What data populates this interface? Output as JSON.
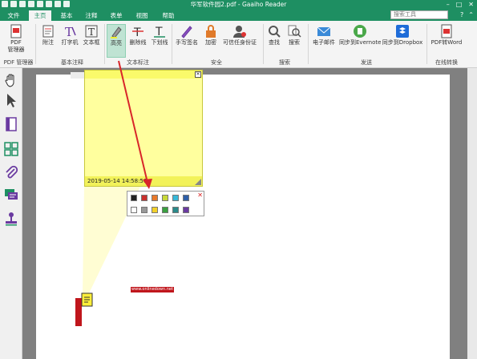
{
  "window": {
    "title": "华军软件园2.pdf - Gaaiho Reader"
  },
  "tabs": [
    {
      "label": "文件"
    },
    {
      "label": "主页"
    },
    {
      "label": "基本"
    },
    {
      "label": "注释"
    },
    {
      "label": "表单"
    },
    {
      "label": "视图"
    },
    {
      "label": "帮助"
    }
  ],
  "search": {
    "placeholder": "搜索工具"
  },
  "ribbon": {
    "buttons": [
      {
        "label": "PDF\n管理器"
      },
      {
        "label": "附注"
      },
      {
        "label": "打字机"
      },
      {
        "label": "文本框"
      },
      {
        "label": "高亮"
      },
      {
        "label": "删除线"
      },
      {
        "label": "下划线"
      },
      {
        "label": "手写签名"
      },
      {
        "label": "加密"
      },
      {
        "label": "可信任身份证"
      },
      {
        "label": "查找"
      },
      {
        "label": "搜索"
      },
      {
        "label": "电子邮件"
      },
      {
        "label": "同步到Evernote"
      },
      {
        "label": "同步到Dropbox"
      },
      {
        "label": "PDF转Word"
      }
    ],
    "groups": [
      {
        "label": "PDF 管理器"
      },
      {
        "label": "基本注释"
      },
      {
        "label": "文本标注"
      },
      {
        "label": "安全"
      },
      {
        "label": "搜索"
      },
      {
        "label": "发送"
      },
      {
        "label": "在线转换"
      }
    ]
  },
  "note": {
    "timestamp": "2019-05-14 14:58:56"
  },
  "palette": {
    "colors_row1": [
      "#222222",
      "#c9302c",
      "#e8782a",
      "#c8d838",
      "#38b8d8",
      "#2e5fa8",
      "#444444"
    ],
    "colors_row2": [
      "#ffffff",
      "#999999",
      "#f2d02a",
      "#3aa040",
      "#2a8a8a",
      "#6a3aa0",
      "#8a8a8a"
    ]
  },
  "annotation": {
    "tag_text": "www.onlinedown.net"
  },
  "colors": {
    "brand": "#1e8f62",
    "note_bg": "#ffff9e",
    "arrow": "#d8262a"
  }
}
